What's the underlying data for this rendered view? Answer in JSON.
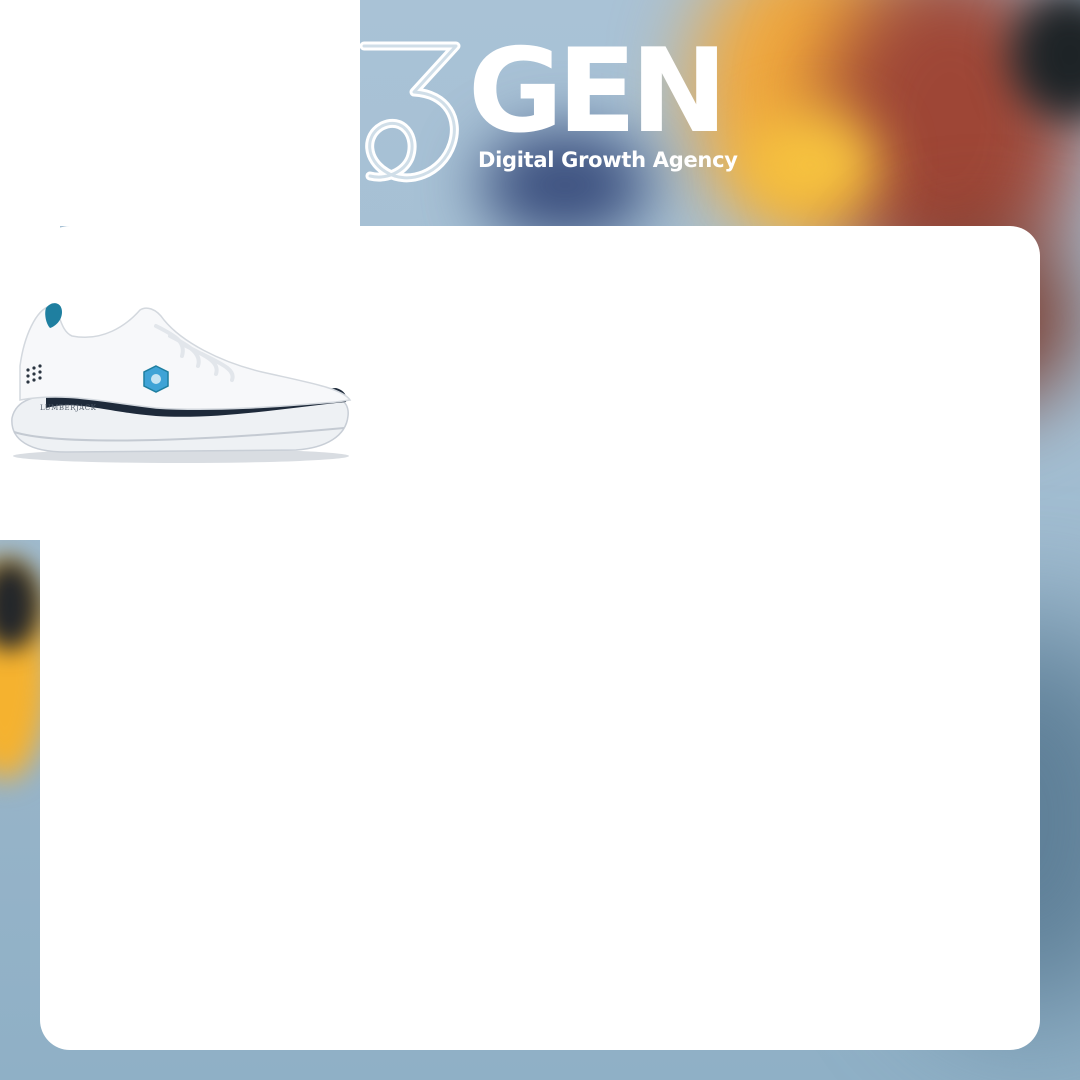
{
  "brand": {
    "mark": "3",
    "name": "GEN",
    "tagline": "Digital Growth Agency"
  },
  "product": {
    "image": "white-knit-running-sneaker",
    "brand_label": "LUMBERJACK"
  },
  "colors": {
    "white": "#ffffff",
    "sky_blue": "#a9c2d6",
    "accent_teal": "#1f7fa0",
    "navy": "#1e2a3a"
  }
}
